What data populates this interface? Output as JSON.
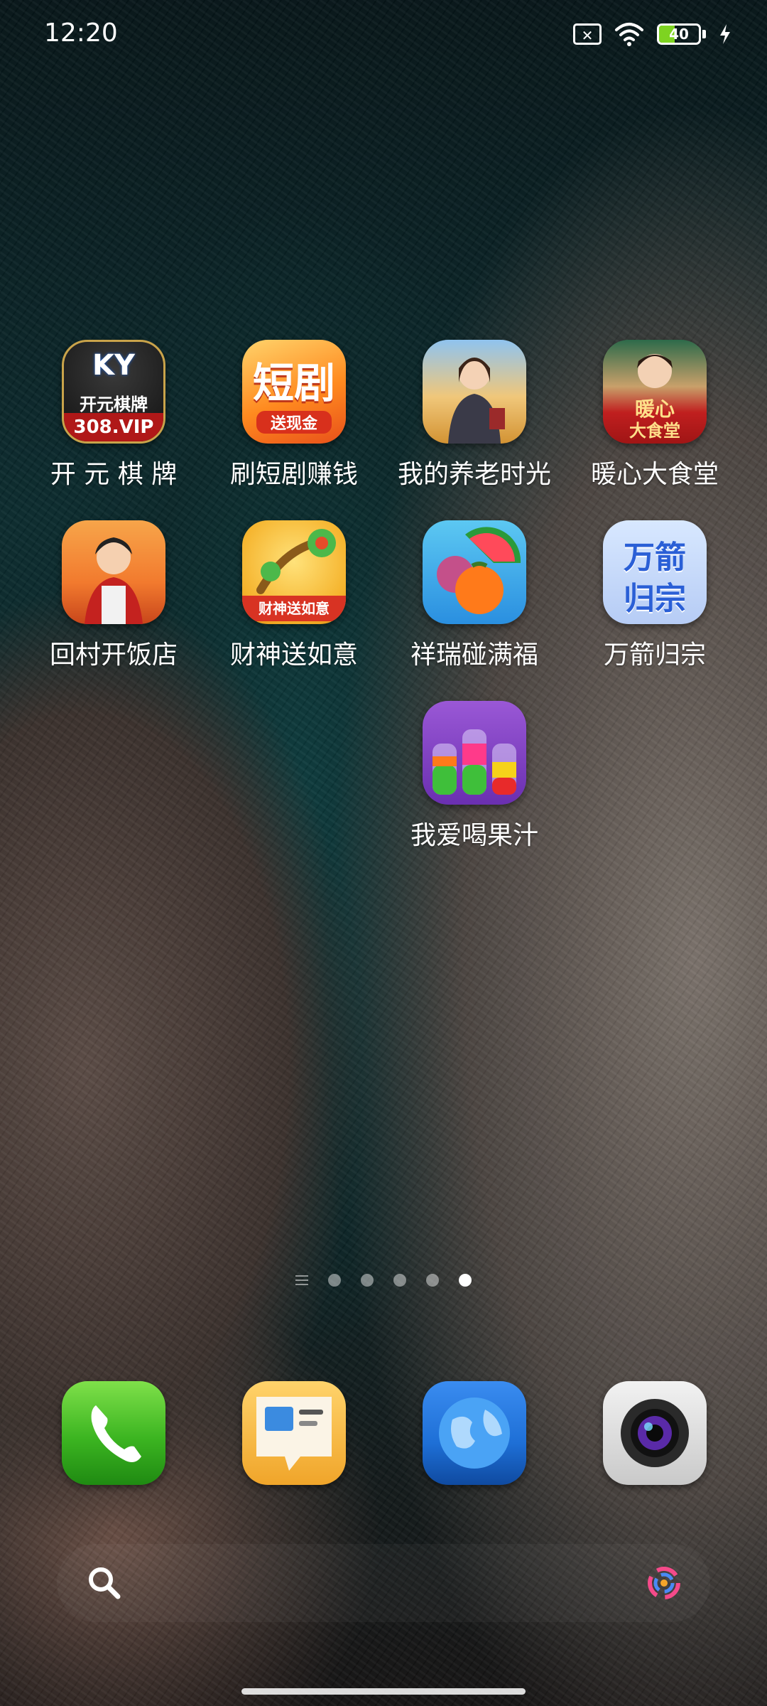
{
  "status_bar": {
    "time": "12:20",
    "battery_level": "40",
    "battery_fraction": 0.4,
    "icons": [
      "sim-off-icon",
      "wifi-icon",
      "battery-icon",
      "charging-icon"
    ]
  },
  "home": {
    "apps": [
      {
        "label": "开 元 棋 牌",
        "icon": "kaiyuan-qipai-icon",
        "icon_lines": [
          "KY",
          "开元棋牌",
          "308.VIP"
        ]
      },
      {
        "label": "刷短剧赚钱",
        "icon": "short-drama-icon",
        "icon_lines": [
          "短剧",
          "送现金"
        ]
      },
      {
        "label": "我的养老时光",
        "icon": "retirement-time-icon"
      },
      {
        "label": "暖心大食堂",
        "icon": "warm-canteen-icon",
        "icon_lines": [
          "暖心",
          "大食堂"
        ]
      },
      {
        "label": "回村开饭店",
        "icon": "village-restaurant-icon"
      },
      {
        "label": "财神送如意",
        "icon": "god-of-wealth-icon",
        "icon_lines": [
          "财神送如意"
        ]
      },
      {
        "label": "祥瑞碰满福",
        "icon": "fruit-match-icon"
      },
      {
        "label": "万箭归宗",
        "icon": "wanjian-guizong-icon",
        "icon_lines": [
          "万箭",
          "归宗"
        ]
      },
      {
        "label": "我爱喝果汁",
        "icon": "juice-sort-icon"
      }
    ],
    "pages": {
      "count": 5,
      "current": 5
    }
  },
  "dock": {
    "apps": [
      "phone-icon",
      "messages-icon",
      "browser-icon",
      "camera-icon"
    ]
  },
  "search": {
    "icons": [
      "search-icon",
      "assistant-icon"
    ]
  },
  "colors": {
    "battery_fill": "#7ed321",
    "phone_green": "#3cb521",
    "browser_blue": "#1e6fd6"
  }
}
